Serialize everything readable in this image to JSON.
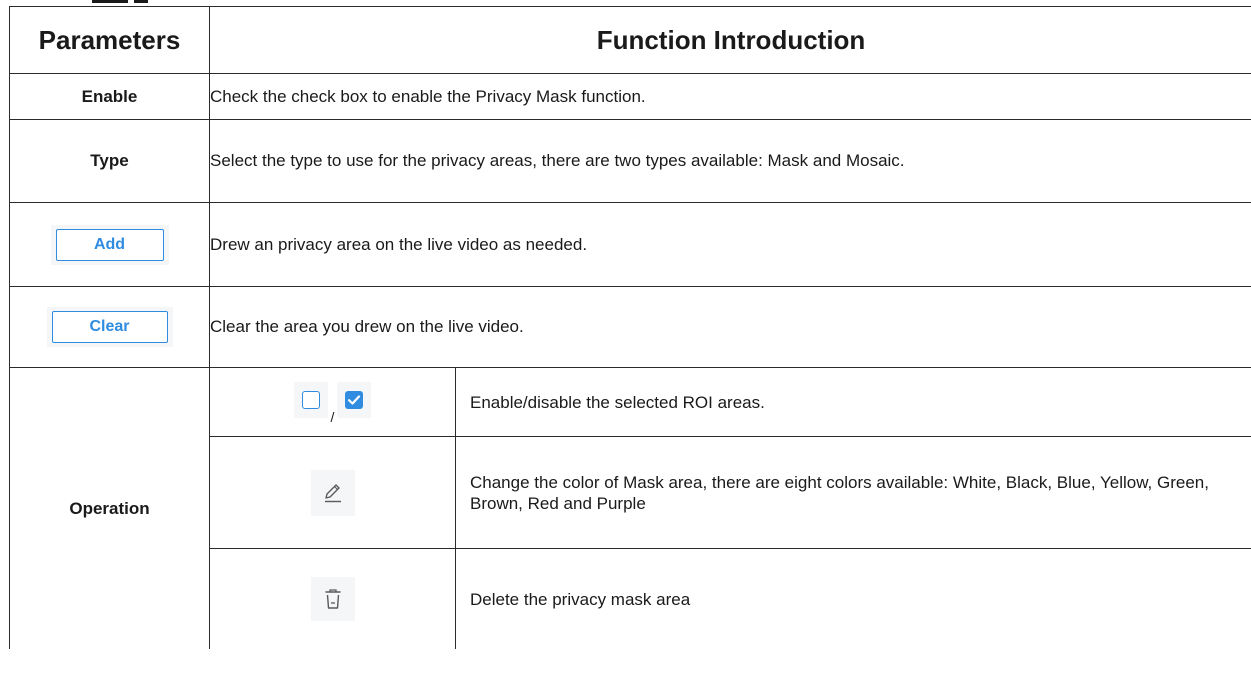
{
  "table": {
    "headers": {
      "parameters": "Parameters",
      "function": "Function Introduction"
    },
    "rows": {
      "enable": {
        "name": "Enable",
        "desc": "Check the check box to enable the Privacy Mask function."
      },
      "type": {
        "name": "Type",
        "desc": "Select the type to use for the privacy areas, there are two types available: Mask and Mosaic."
      },
      "add": {
        "button_label": "Add",
        "desc": "Drew an privacy area on the live video as needed."
      },
      "clear": {
        "button_label": "Clear",
        "desc": "Clear the area you drew on the live video."
      },
      "operation": {
        "name": "Operation",
        "items": [
          {
            "icon": "checkbox-toggle-icon",
            "separator": "/",
            "desc": "Enable/disable the selected ROI areas."
          },
          {
            "icon": "pencil-edit-icon",
            "desc": "Change the color of Mask area, there are eight colors available: White, Black, Blue, Yellow, Green, Brown, Red and Purple"
          },
          {
            "icon": "trash-delete-icon",
            "desc": "Delete the privacy mask area"
          }
        ]
      }
    }
  },
  "colors": {
    "accent": "#2f8ce0",
    "icon_gray": "#5a5a5a",
    "icon_bg": "#f4f6f8",
    "border": "#2b2b2b"
  }
}
